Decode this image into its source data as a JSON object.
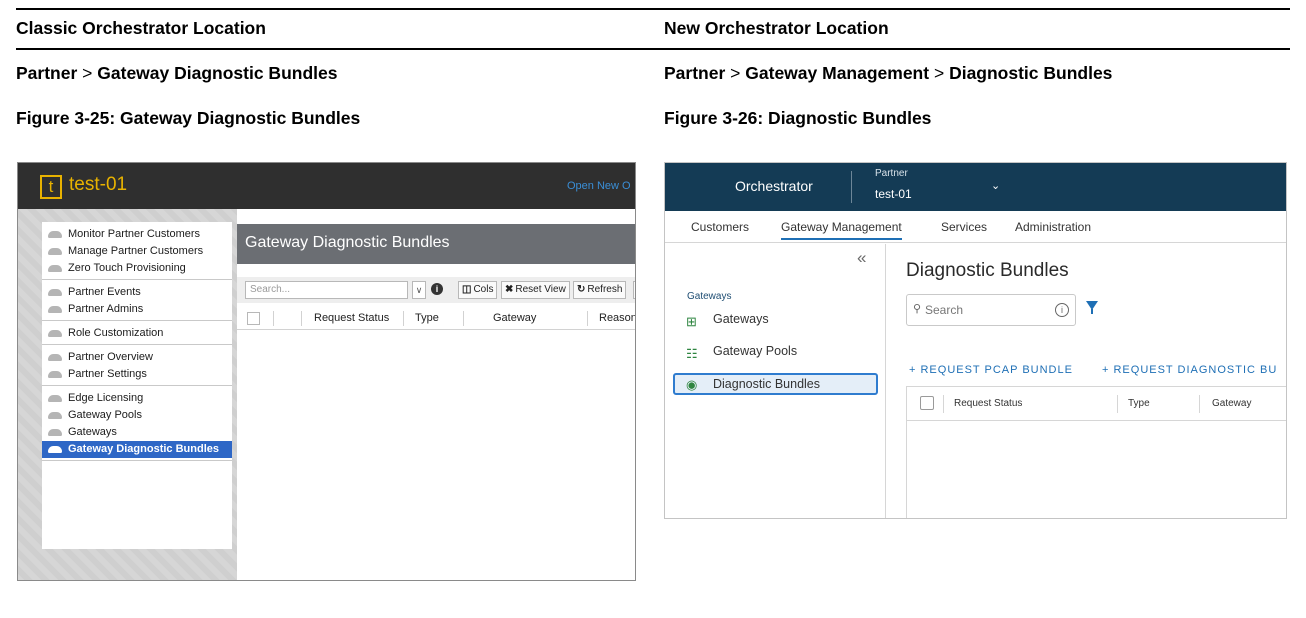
{
  "table": {
    "left_header": "Classic Orchestrator Location",
    "right_header": "New Orchestrator Location",
    "left_path": [
      "Partner",
      "Gateway Diagnostic Bundles"
    ],
    "right_path": [
      "Partner",
      "Gateway Management",
      "Diagnostic Bundles"
    ],
    "path_separator": ">",
    "left_caption": "Figure 3-25: Gateway Diagnostic Bundles",
    "right_caption": "Figure 3-26: Diagnostic Bundles"
  },
  "classic": {
    "logo_letter": "t",
    "title": "test-01",
    "top_link": "Open New O",
    "nav_groups": [
      [
        "Monitor Partner Customers",
        "Manage Partner Customers",
        "Zero Touch Provisioning"
      ],
      [
        "Partner Events",
        "Partner Admins"
      ],
      [
        "Role Customization"
      ],
      [
        "Partner Overview",
        "Partner Settings"
      ],
      [
        "Edge Licensing",
        "Gateway Pools",
        "Gateways",
        "Gateway Diagnostic Bundles"
      ]
    ],
    "active_item": "Gateway Diagnostic Bundles",
    "content_title": "Gateway Diagnostic Bundles",
    "search_placeholder": "Search...",
    "buttons": {
      "cols": "Cols",
      "reset": "Reset View",
      "refresh": "Refresh"
    },
    "columns": [
      "Request Status",
      "Type",
      "Gateway",
      "Reason"
    ]
  },
  "newui": {
    "brand": "Orchestrator",
    "context_label": "Partner",
    "context_value": "test-01",
    "tabs": [
      "Customers",
      "Gateway Management",
      "Services",
      "Administration"
    ],
    "active_tab": "Gateway Management",
    "collapse_glyph": "«",
    "side_heading": "Gateways",
    "side_items": [
      "Gateways",
      "Gateway Pools",
      "Diagnostic Bundles"
    ],
    "active_side_item": "Diagnostic Bundles",
    "page_title": "Diagnostic Bundles",
    "search_placeholder": "Search",
    "actions": [
      "+ REQUEST PCAP BUNDLE",
      "+ REQUEST DIAGNOSTIC BU"
    ],
    "columns": [
      "Request Status",
      "Type",
      "Gateway"
    ]
  }
}
